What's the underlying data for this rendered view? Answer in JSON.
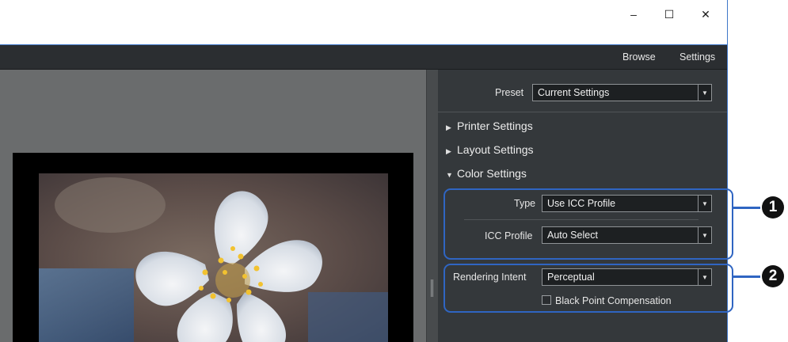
{
  "window": {
    "controls": {
      "minimize": "–",
      "maximize": "☐",
      "close": "✕"
    }
  },
  "menu": {
    "browse": "Browse",
    "settings": "Settings"
  },
  "panel": {
    "preset": {
      "label": "Preset",
      "value": "Current Settings"
    },
    "sections": {
      "printer": "Printer Settings",
      "layout": "Layout Settings",
      "color": "Color Settings"
    },
    "type": {
      "label": "Type",
      "value": "Use ICC Profile"
    },
    "icc_profile": {
      "label": "ICC Profile",
      "value": "Auto Select"
    },
    "rendering_intent": {
      "label": "Rendering Intent",
      "value": "Perceptual"
    },
    "black_point": {
      "label": "Black Point Compensation",
      "checked": false
    }
  },
  "callouts": {
    "one": "1",
    "two": "2"
  },
  "colors": {
    "accent": "#2f65c2",
    "panel_bg": "#34383b",
    "menubar_bg": "#2b2e31"
  }
}
